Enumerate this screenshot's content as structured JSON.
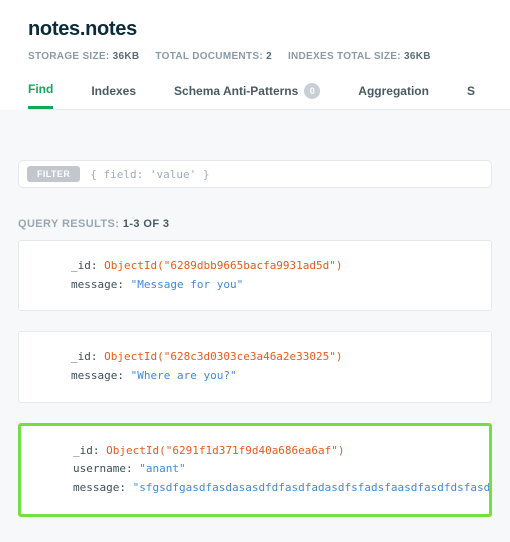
{
  "header": {
    "title": "notes.notes",
    "stats": {
      "storage_label": "STORAGE SIZE:",
      "storage_value": "36KB",
      "docs_label": "TOTAL DOCUMENTS:",
      "docs_value": "2",
      "indexes_label": "INDEXES TOTAL SIZE:",
      "indexes_value": "36KB"
    }
  },
  "tabs": {
    "find": "Find",
    "indexes": "Indexes",
    "schema": "Schema Anti-Patterns",
    "schema_badge": "0",
    "aggregation": "Aggregation",
    "search": "S"
  },
  "filter": {
    "button": "FILTER",
    "placeholder": "{ field: 'value' }"
  },
  "results": {
    "label": "QUERY RESULTS:",
    "range": "1-3 OF 3"
  },
  "docs": [
    {
      "fields": [
        {
          "key": "_id",
          "type": "objectid",
          "value": "ObjectId(\"6289dbb9665bacfa9931ad5d\")"
        },
        {
          "key": "message",
          "type": "string",
          "value": "\"Message for you\""
        }
      ],
      "highlight": false
    },
    {
      "fields": [
        {
          "key": "_id",
          "type": "objectid",
          "value": "ObjectId(\"628c3d0303ce3a46a2e33025\")"
        },
        {
          "key": "message",
          "type": "string",
          "value": "\"Where are you?\""
        }
      ],
      "highlight": false
    },
    {
      "fields": [
        {
          "key": "_id",
          "type": "objectid",
          "value": "ObjectId(\"6291f1d371f9d40a686ea6af\")"
        },
        {
          "key": "username",
          "type": "string",
          "value": "\"anant\""
        },
        {
          "key": "message",
          "type": "string",
          "value": "\"sfgsdfgasdfasdasasdfdfasdfadasdfsfadsfaasdfasdfdsfasdfasdfasfd\""
        }
      ],
      "highlight": true
    }
  ]
}
